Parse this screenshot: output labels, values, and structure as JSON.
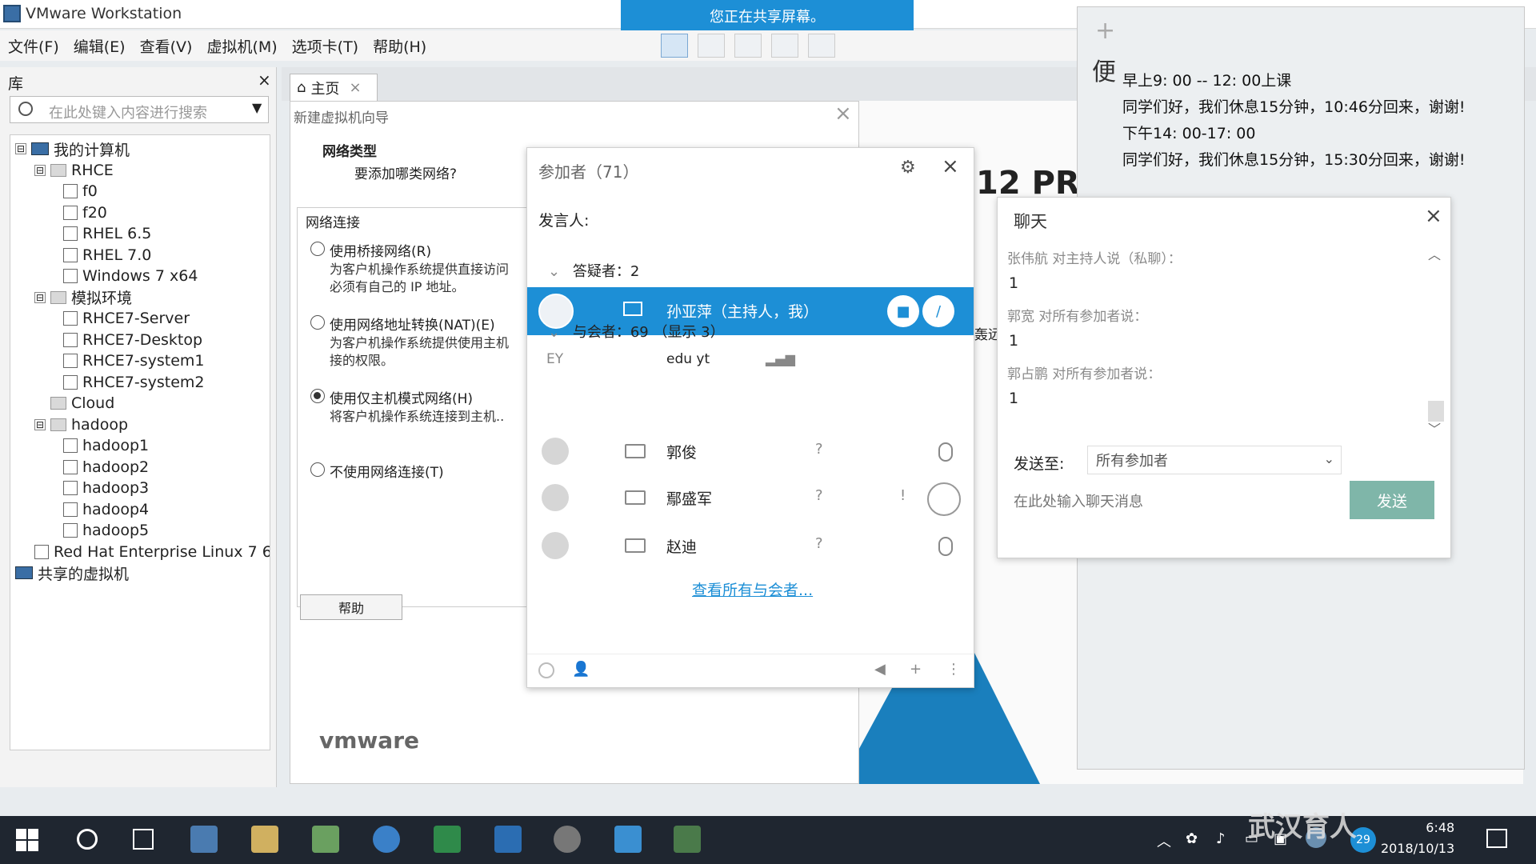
{
  "window": {
    "title": "VMware Workstation"
  },
  "share_banner": "您正在共享屏幕。",
  "menu": [
    "文件(F)",
    "编辑(E)",
    "查看(V)",
    "虚拟机(M)",
    "选项卡(T)",
    "帮助(H)"
  ],
  "library": {
    "title": "库",
    "close": "×",
    "search_placeholder": "在此处键入内容进行搜索",
    "tree": [
      {
        "label": "我的计算机",
        "level": 0,
        "kind": "pc",
        "toggle": "⊟"
      },
      {
        "label": "RHCE",
        "level": 1,
        "kind": "folder",
        "toggle": "⊟"
      },
      {
        "label": "f0",
        "level": 2,
        "kind": "vm"
      },
      {
        "label": "f20",
        "level": 2,
        "kind": "vm"
      },
      {
        "label": "RHEL 6.5",
        "level": 2,
        "kind": "vm"
      },
      {
        "label": "RHEL 7.0",
        "level": 2,
        "kind": "vm"
      },
      {
        "label": "Windows 7 x64",
        "level": 2,
        "kind": "vm"
      },
      {
        "label": "模拟环境",
        "level": 1,
        "kind": "folder",
        "toggle": "⊟"
      },
      {
        "label": "RHCE7-Server",
        "level": 2,
        "kind": "vm"
      },
      {
        "label": "RHCE7-Desktop",
        "level": 2,
        "kind": "vm"
      },
      {
        "label": "RHCE7-system1",
        "level": 2,
        "kind": "vm"
      },
      {
        "label": "RHCE7-system2",
        "level": 2,
        "kind": "vm"
      },
      {
        "label": "Cloud",
        "level": 1,
        "kind": "folder"
      },
      {
        "label": "hadoop",
        "level": 1,
        "kind": "folder",
        "toggle": "⊟"
      },
      {
        "label": "hadoop1",
        "level": 2,
        "kind": "vm"
      },
      {
        "label": "hadoop2",
        "level": 2,
        "kind": "vm"
      },
      {
        "label": "hadoop3",
        "level": 2,
        "kind": "vm"
      },
      {
        "label": "hadoop4",
        "level": 2,
        "kind": "vm"
      },
      {
        "label": "hadoop5",
        "level": 2,
        "kind": "vm"
      },
      {
        "label": "Red Hat Enterprise Linux 7 6",
        "level": 1,
        "kind": "vm"
      },
      {
        "label": "共享的虚拟机",
        "level": 0,
        "kind": "pc"
      }
    ]
  },
  "tabs": {
    "home": "主页",
    "close": "×"
  },
  "wizard": {
    "title": "新建虚拟机向导",
    "section_title": "网络类型",
    "section_sub": "要添加哪类网络?",
    "group_legend": "网络连接",
    "options": [
      {
        "label": "使用桥接网络(R)",
        "desc": "为客户机操作系统提供直接访问外部以太网络的权限。客户机在外部网络上必须有自己的 IP 地址。",
        "desc_shown": "为客户机操作系统提供直接访问\n必须有自己的 IP 地址。",
        "checked": false
      },
      {
        "label": "使用网络地址转换(NAT)(E)",
        "desc_shown": "为客户机操作系统提供使用主机\n接的权限。",
        "checked": false
      },
      {
        "label": "使用仅主机模式网络(H)",
        "desc_shown": "将客户机操作系统连接到主机..",
        "checked": true
      },
      {
        "label": "不使用网络连接(T)",
        "desc_shown": "",
        "checked": false
      }
    ],
    "help_button": "帮助",
    "logo": "vmware"
  },
  "participants": {
    "title": "参加者（71）",
    "speaker_label": "发言人:",
    "questioners": "答疑者：2",
    "host_name": "孙亚萍（主持人，我）",
    "ey_initials": "EY",
    "ey_name": "edu yt",
    "attendees": "与会者：69 （显示 3）",
    "rows": [
      {
        "name": "郭俊",
        "q": "?"
      },
      {
        "name": "鄢盛军",
        "q": "?"
      },
      {
        "name": "赵迪",
        "q": "?"
      }
    ],
    "see_all": "查看所有与会者...",
    "accent": "#1d8fd6"
  },
  "notes": {
    "header": "便",
    "lines": [
      "早上9: 00 -- 12: 00上课",
      "同学们好，我们休息15分钟，10:46分回来，谢谢!",
      "下午14: 00-17: 00",
      "同学们好，我们休息15分钟，15:30分回来，谢谢!"
    ]
  },
  "background": {
    "big_text": "12 PR",
    "side_text": "轰远"
  },
  "chat": {
    "title": "聊天",
    "messages": [
      {
        "header": "张伟航 对主持人说（私聊）：",
        "body": "1"
      },
      {
        "header": "郭宽 对所有参加者说：",
        "body": "1"
      },
      {
        "header": "郭占鹏 对所有参加者说：",
        "body": "1"
      }
    ],
    "send_to_label": "发送至:",
    "send_to_value": "所有参加者",
    "input_placeholder": "在此处输入聊天消息",
    "send_button": "发送",
    "send_color": "#7fb6a9"
  },
  "taskbar": {
    "time": "6:48",
    "date": "2018/10/13",
    "badge": "29",
    "watermark": "武汉育人"
  }
}
